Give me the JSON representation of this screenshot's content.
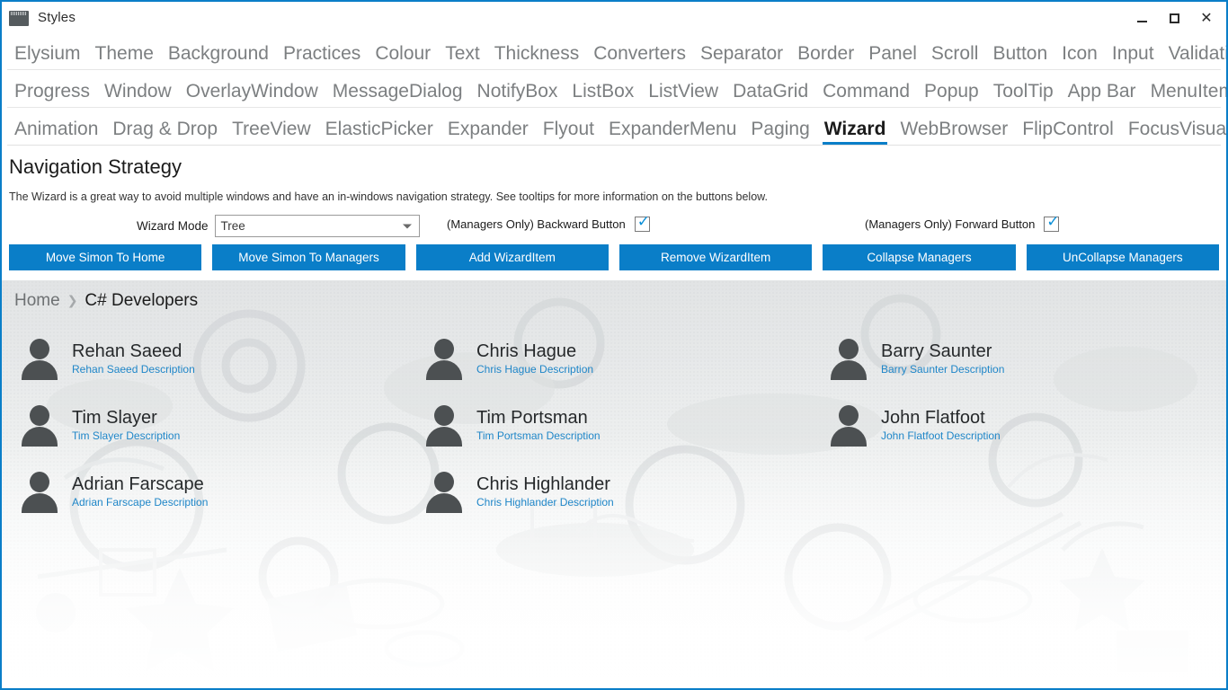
{
  "window": {
    "title": "Styles",
    "icon": "folder-icon",
    "controls": {
      "minimize": "minimize-icon",
      "maximize": "maximize-icon",
      "close": "close-icon"
    },
    "accent_color": "#0a7ec8",
    "border_color": "#0a7ec8"
  },
  "tabs": {
    "rows": [
      [
        "Elysium",
        "Theme",
        "Background",
        "Practices",
        "Colour",
        "Text",
        "Thickness",
        "Converters",
        "Separator",
        "Border",
        "Panel",
        "Scroll",
        "Button",
        "Icon",
        "Input",
        "Validation"
      ],
      [
        "Progress",
        "Window",
        "OverlayWindow",
        "MessageDialog",
        "NotifyBox",
        "ListBox",
        "ListView",
        "DataGrid",
        "Command",
        "Popup",
        "ToolTip",
        "App Bar",
        "MenuItem"
      ],
      [
        "Animation",
        "Drag & Drop",
        "TreeView",
        "ElasticPicker",
        "Expander",
        "Flyout",
        "ExpanderMenu",
        "Paging",
        "Wizard",
        "WebBrowser",
        "FlipControl",
        "FocusVisualStyle"
      ]
    ],
    "active": "Wizard"
  },
  "header": {
    "heading": "Navigation Strategy",
    "description": "The Wizard is a great way to avoid multiple windows and have an in-windows navigation strategy. See tooltips for more information on the buttons below."
  },
  "controls": {
    "wizard_mode": {
      "label": "Wizard Mode",
      "value": "Tree",
      "options": [
        "Tree"
      ]
    },
    "backward_button": {
      "label": "(Managers Only) Backward Button",
      "checked": true,
      "check_glyph": "✓"
    },
    "forward_button": {
      "label": "(Managers Only) Forward Button",
      "checked": true,
      "check_glyph": "✓"
    }
  },
  "buttons": [
    {
      "label": "Move Simon To Home"
    },
    {
      "label": "Move Simon To Managers"
    },
    {
      "label": "Add WizardItem"
    },
    {
      "label": "Remove WizardItem"
    },
    {
      "label": "Collapse Managers"
    },
    {
      "label": "UnCollapse Managers"
    }
  ],
  "wizard": {
    "breadcrumb": {
      "items": [
        "Home",
        "C# Developers"
      ],
      "separator": "❯",
      "current_index": 1
    },
    "people": [
      {
        "name": "Rehan Saeed",
        "description": "Rehan Saeed Description",
        "avatar": "person-avatar-icon"
      },
      {
        "name": "Chris Hague",
        "description": "Chris Hague Description",
        "avatar": "person-avatar-icon"
      },
      {
        "name": "Barry Saunter",
        "description": "Barry Saunter Description",
        "avatar": "person-avatar-icon"
      },
      {
        "name": "Tim Slayer",
        "description": "Tim Slayer Description",
        "avatar": "person-avatar-icon"
      },
      {
        "name": "Tim Portsman",
        "description": "Tim Portsman Description",
        "avatar": "person-avatar-icon"
      },
      {
        "name": "John Flatfoot",
        "description": "John Flatfoot Description",
        "avatar": "person-avatar-icon"
      },
      {
        "name": "Adrian Farscape",
        "description": "Adrian Farscape Description",
        "avatar": "person-avatar-icon"
      },
      {
        "name": "Chris Highlander",
        "description": "Chris Highlander Description",
        "avatar": "person-avatar-icon"
      }
    ]
  }
}
